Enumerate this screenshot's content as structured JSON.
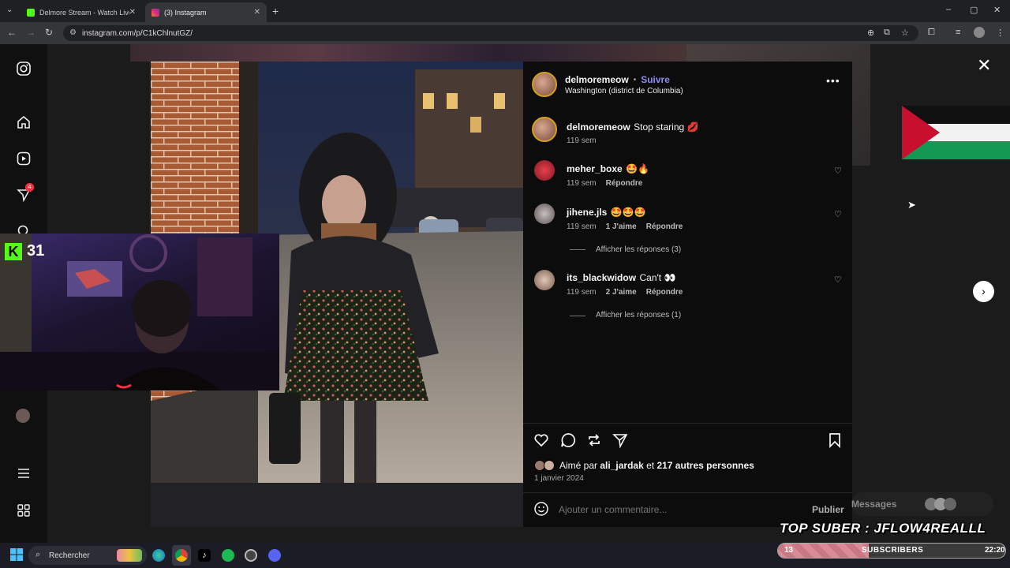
{
  "browser": {
    "tabs": [
      {
        "title": "Delmore Stream - Watch Live o",
        "active": false
      },
      {
        "title": "(3) Instagram",
        "active": true
      }
    ],
    "url": "instagram.com/p/C1kChlnutGZ/"
  },
  "left_nav": {
    "notifications_badge": "4"
  },
  "post": {
    "author": "delmoremeow",
    "follow_label": "Suivre",
    "location": "Washington (district de Columbia)",
    "caption_author": "delmoremeow",
    "caption": "Stop staring 💋",
    "caption_time": "119 sem",
    "comments": [
      {
        "user": "meher_boxe",
        "text": "🤩🔥",
        "time": "119 sem",
        "likes": "",
        "reply": "Répondre",
        "view_replies": ""
      },
      {
        "user": "jihene.jls",
        "text": "🤩🤩🤩",
        "time": "119 sem",
        "likes": "1 J'aime",
        "reply": "Répondre",
        "view_replies": "Afficher les réponses (3)"
      },
      {
        "user": "its_blackwidow",
        "text": "Can't 👀",
        "time": "119 sem",
        "likes": "2 J'aime",
        "reply": "Répondre",
        "view_replies": "Afficher les réponses (1)"
      }
    ],
    "liked_by_prefix": "Aimé par",
    "liked_by_user": "ali_jardak",
    "liked_by_joiner": "et",
    "liked_by_others": "217 autres personnes",
    "date": "1 janvier 2024",
    "comment_placeholder": "Ajouter un commentaire...",
    "publish_label": "Publier"
  },
  "messages_label": "Messages",
  "stream_overlay": {
    "kick_count": "31",
    "top_suber": "TOP SUBER : JFLOW4REALLL",
    "sub_count": "13",
    "sub_label": "SUBSCRIBERS",
    "sub_progress": 0.4
  },
  "taskbar": {
    "search_label": "Rechercher",
    "clock": "22:20"
  },
  "colors": {
    "instagram_follow": "#8c8cf5",
    "kick_green": "#53fc18",
    "palestine_red": "#c8102e",
    "palestine_green": "#149954"
  }
}
